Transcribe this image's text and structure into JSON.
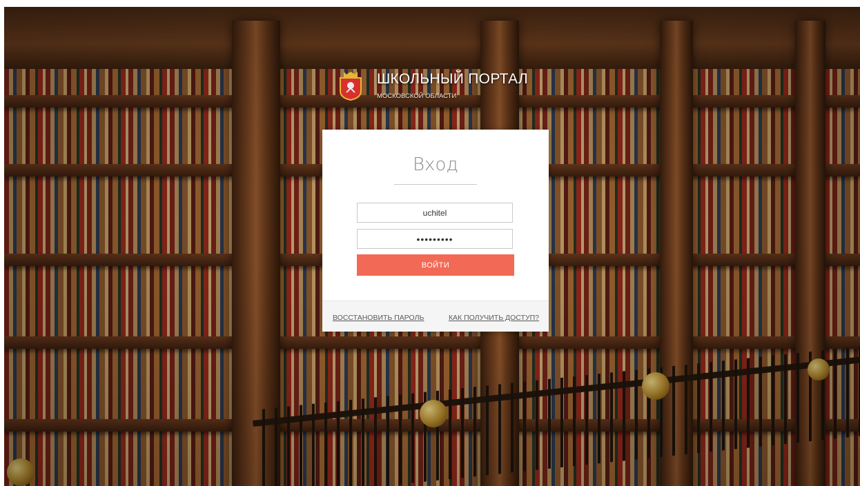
{
  "brand": {
    "title": "ШКОЛЬНЫЙ ПОРТАЛ",
    "subtitle": "МОСКОВСКОЙ ОБЛАСТИ",
    "emblem_icon": "moscow-oblast-coat-of-arms-icon"
  },
  "login_form": {
    "heading": "Вход",
    "login_value": "uchitel",
    "password_value": "•••••••••",
    "submit_label": "ВОЙТИ",
    "restore_password_label": "ВОССТАНОВИТЬ ПАРОЛЬ",
    "get_access_label": "КАК ПОЛУЧИТЬ ДОСТУП?"
  },
  "colors": {
    "accent": "#f26a55",
    "card_background": "#ffffff",
    "footer_background": "#f5f5f5"
  }
}
